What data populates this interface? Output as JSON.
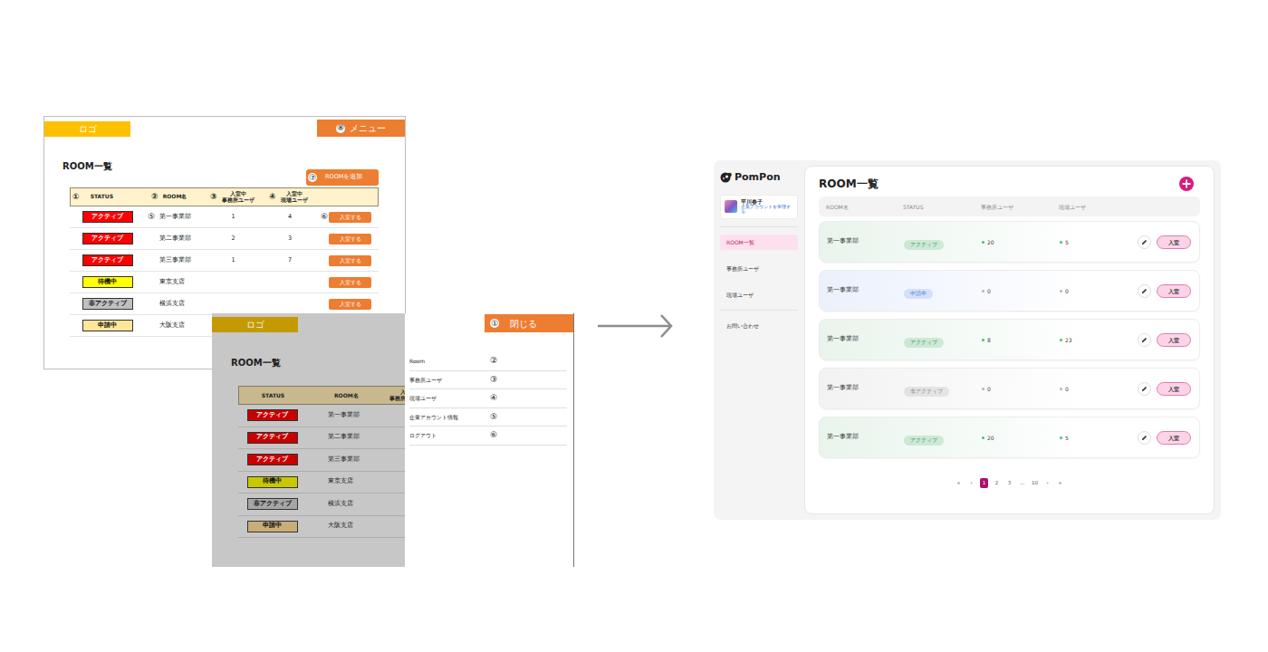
{
  "wireframe_list": {
    "logo": "ロゴ",
    "menu_button": {
      "num": "⑧",
      "label": "メニュー"
    },
    "title": "ROOM一覧",
    "add_button": {
      "num": "⑦",
      "label": "ROOMを追加"
    },
    "columns": [
      {
        "num": "①",
        "label": "STATUS"
      },
      {
        "num": "②",
        "label": "ROOM名"
      },
      {
        "num": "③",
        "label": "入室中\n事務所ユーザ"
      },
      {
        "num": "④",
        "label": "入室中\n現場ユーザ"
      }
    ],
    "rows": [
      {
        "status": "アクティブ",
        "color": "#ff0000",
        "name_num": "⑤",
        "name": "第一事業部",
        "office": "1",
        "site": "4",
        "button_num": "⑥",
        "button": "入室する"
      },
      {
        "status": "アクティブ",
        "color": "#ff0000",
        "name": "第二事業部",
        "office": "2",
        "site": "3",
        "button": "入室する"
      },
      {
        "status": "アクティブ",
        "color": "#ff0000",
        "name": "第三事業部",
        "office": "1",
        "site": "7",
        "button": "入室する"
      },
      {
        "status": "待機中",
        "color": "#ffff00",
        "name": "東京支店",
        "button": "入室する"
      },
      {
        "status": "非アクティブ",
        "color": "#c0c0c0",
        "name": "横浜支店",
        "button": "入室する"
      },
      {
        "status": "申請中",
        "color": "#ffe699",
        "name": "大阪支店"
      }
    ]
  },
  "wireframe_menu": {
    "logo": "ロゴ",
    "title": "ROOM一覧",
    "columns": [
      "STATUS",
      "ROOM名",
      "入\n事務所"
    ],
    "rows": [
      {
        "status": "アクティブ",
        "color": "#c80000",
        "name": "第一事業部"
      },
      {
        "status": "アクティブ",
        "color": "#c80000",
        "name": "第二事業部"
      },
      {
        "status": "アクティブ",
        "color": "#c80000",
        "name": "第三事業部"
      },
      {
        "status": "待機中",
        "color": "#c8c800",
        "name": "東京支店"
      },
      {
        "status": "非アクティブ",
        "color": "#a6a6a6",
        "name": "横浜支店"
      },
      {
        "status": "申請中",
        "color": "#c9ad78",
        "name": "大阪支店"
      }
    ],
    "close_button": {
      "num": "①",
      "label": "閉じる"
    },
    "items": [
      {
        "label": "Room",
        "num": "②"
      },
      {
        "label": "事務所ユーザ",
        "num": "③"
      },
      {
        "label": "現場ユーザ",
        "num": "④"
      },
      {
        "label": "企業アカウント情報",
        "num": "⑤"
      },
      {
        "label": "ログアウト",
        "num": "⑥"
      }
    ]
  },
  "app": {
    "logo": "PomPon",
    "user": {
      "name": "平川春子",
      "link": "企業アカウントを管理する"
    },
    "nav": [
      {
        "label": "ROOM一覧",
        "selected": true
      },
      {
        "label": "事務所ユーザ",
        "selected": false
      },
      {
        "label": "現場ユーザ",
        "selected": false
      }
    ],
    "support": "お問い合わせ",
    "title": "ROOM一覧",
    "columns": [
      "ROOM名",
      "STATUS",
      "事務所ユーザ",
      "現場ユーザ"
    ],
    "rows": [
      {
        "name": "第一事業部",
        "status": "アクティブ",
        "color": "#2f9e52",
        "office": "20",
        "office_color": "#3cc46b",
        "site": "5",
        "site_color": "#3cc46b",
        "enter_button": "入室"
      },
      {
        "name": "第一事業部",
        "status": "申請中",
        "color": "#4a7de0",
        "office": "0",
        "office_color": "#b5b5b5",
        "site": "0",
        "site_color": "#b5b5b5",
        "enter_button": "入室"
      },
      {
        "name": "第一事業部",
        "status": "アクティブ",
        "color": "#2f9e52",
        "office": "8",
        "office_color": "#3cc46b",
        "site": "23",
        "site_color": "#3cc46b",
        "enter_button": "入室"
      },
      {
        "name": "第一事業部",
        "status": "非アクティブ",
        "color": "#8a8a8a",
        "office": "0",
        "office_color": "#b5b5b5",
        "site": "0",
        "site_color": "#b5b5b5",
        "enter_button": "入室"
      },
      {
        "name": "第一事業部",
        "status": "アクティブ",
        "color": "#2f9e52",
        "office": "20",
        "office_color": "#3cc46b",
        "site": "5",
        "site_color": "#3cc46b",
        "enter_button": "入室"
      }
    ],
    "pagination": [
      {
        "label": "«",
        "selected": false
      },
      {
        "label": "‹",
        "selected": false
      },
      {
        "label": "1",
        "selected": true
      },
      {
        "label": "2",
        "selected": false
      },
      {
        "label": "3",
        "selected": false
      },
      {
        "label": "…",
        "selected": false
      },
      {
        "label": "10",
        "selected": false
      },
      {
        "label": "›",
        "selected": false
      },
      {
        "label": "»",
        "selected": false
      }
    ]
  }
}
